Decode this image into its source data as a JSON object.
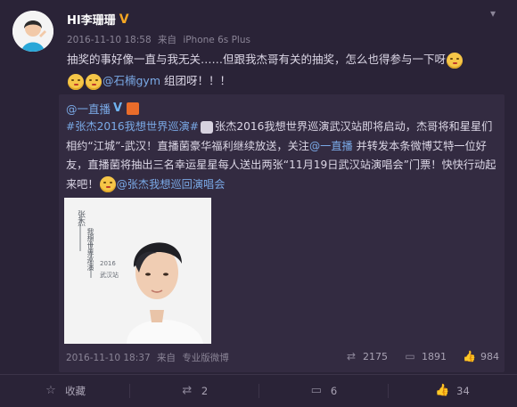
{
  "post": {
    "author": "HI李珊珊",
    "time": "2016-11-10 18:58",
    "source_prefix": "来自",
    "device": "iPhone 6s Plus",
    "text_line1": "抽奖的事好像一直与我无关……但跟我杰哥有关的抽奖，怎么也得参与一下呀",
    "mention": "@石楠gym",
    "text_line2": "组团呀！！！",
    "verified_color": "#f5a623",
    "chevron_icon": "chevron-down-icon"
  },
  "repost": {
    "author": "@一直播",
    "hashtag": "#张杰2016我想世界巡演#",
    "body_part1": "张杰2016我想世界巡演武汉站即将启动，杰哥将和星星们相约“江城”-武汉！直播菌豪华福利继续放送，关注",
    "mention": "@一直播",
    "body_part2": "并转发本条微博艾特一位好友，直播菌将抽出三名幸运星星每人送出两张“11月19日武汉站演唱会”门票！快快行动起来吧！",
    "tail_mention": "@张杰我想巡回演唱会",
    "time": "2016-11-10 18:37",
    "source_prefix": "来自",
    "device": "专业版微博",
    "reposts": "2175",
    "comments": "1891",
    "likes": "984",
    "poster_text": {
      "title": "张杰",
      "subtitle": "我想世界巡演",
      "small1": "2016",
      "small2": "武汉站"
    }
  },
  "actions": {
    "favorite_label": "收藏",
    "repost_count": "2",
    "comment_count": "6",
    "like_count": "34"
  },
  "colors": {
    "background": "#2a2337",
    "repost_bg": "#332b41",
    "link": "#7aa9e6"
  }
}
